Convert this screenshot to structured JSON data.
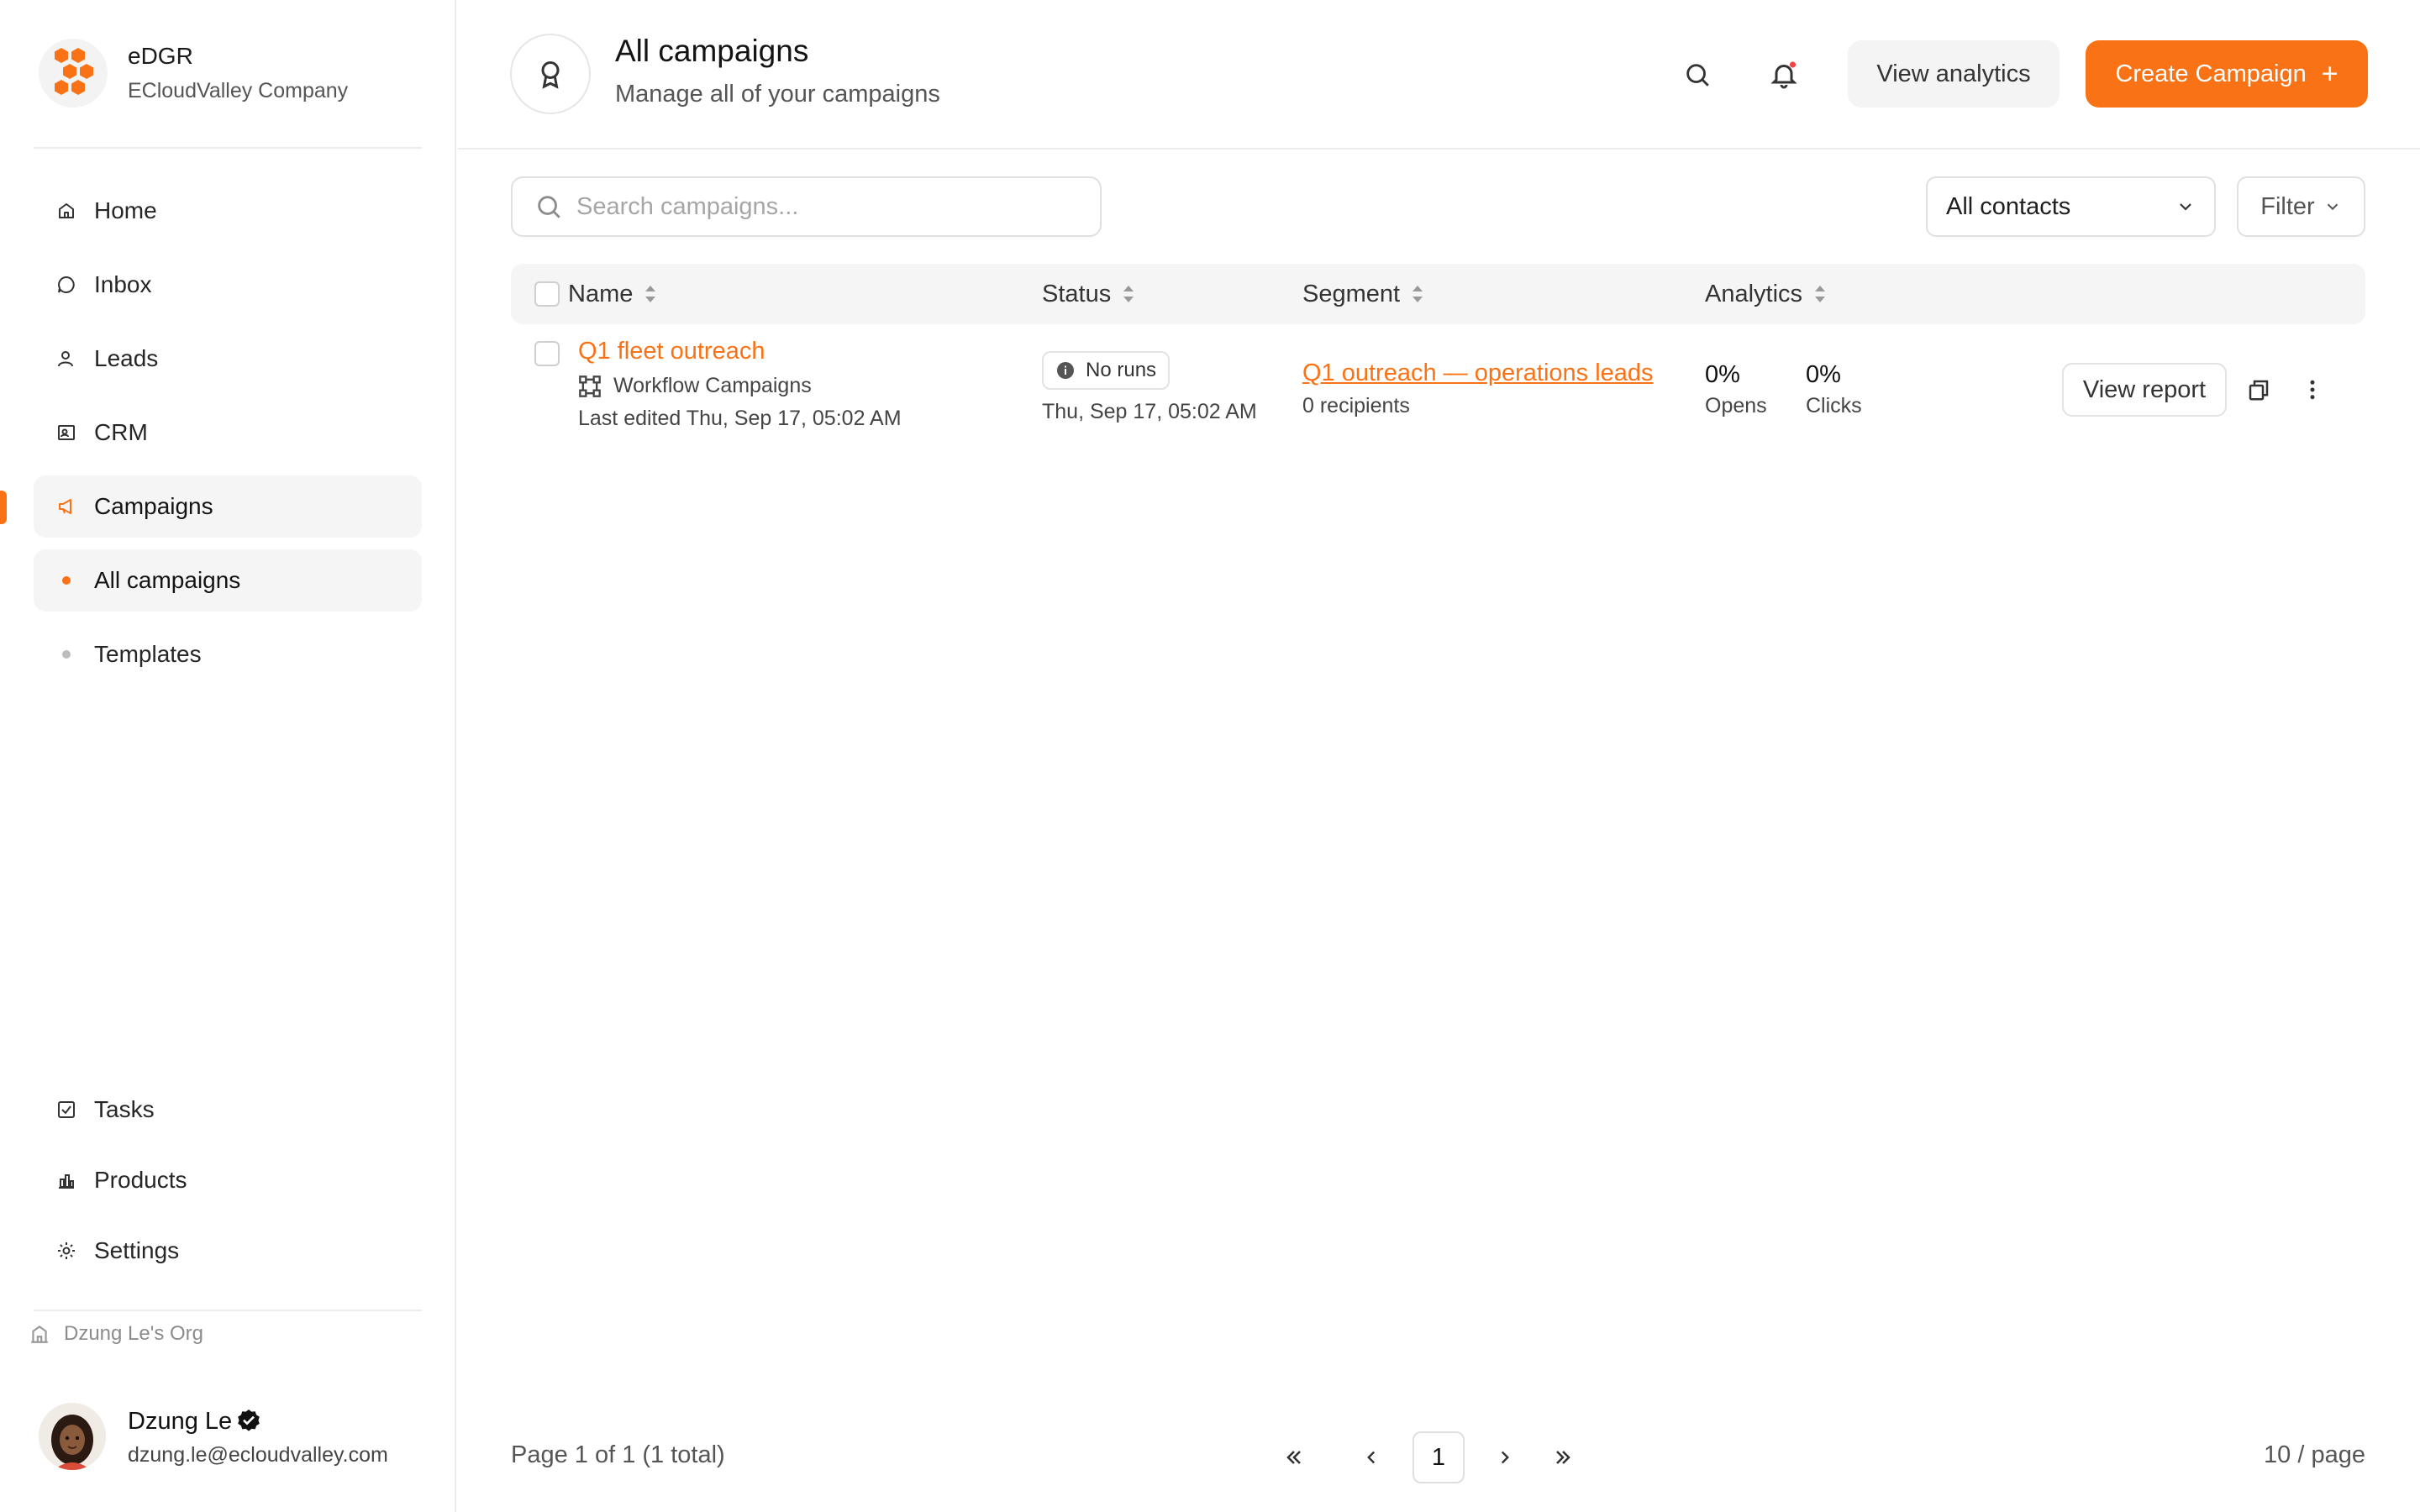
{
  "brand": {
    "name": "eDGR",
    "company": "ECloudValley Company"
  },
  "nav": {
    "home": "Home",
    "inbox": "Inbox",
    "leads": "Leads",
    "crm": "CRM",
    "campaigns": "Campaigns",
    "all_campaigns": "All campaigns",
    "templates": "Templates",
    "tasks": "Tasks",
    "products": "Products",
    "settings": "Settings"
  },
  "org": "Dzung Le's Org",
  "user": {
    "name": "Dzung Le",
    "email": "dzung.le@ecloudvalley.com"
  },
  "header": {
    "title": "All campaigns",
    "subtitle": "Manage all of your campaigns",
    "view_analytics": "View analytics",
    "create_campaign": "Create Campaign",
    "create_plus": "+"
  },
  "toolbar": {
    "search_placeholder": "Search campaigns...",
    "contacts_select": "All contacts",
    "filter_label": "Filter"
  },
  "table": {
    "columns": {
      "name": "Name",
      "status": "Status",
      "segment": "Segment",
      "analytics": "Analytics"
    },
    "rows": [
      {
        "name": "Q1 fleet outreach",
        "type": "Workflow Campaigns",
        "last_edited": "Last edited Thu, Sep 17, 05:02 AM",
        "status_badge": "No runs",
        "status_date": "Thu, Sep 17, 05:02 AM",
        "segment": "Q1 outreach — operations leads",
        "recipients": "0 recipients",
        "opens_value": "0%",
        "opens_label": "Opens",
        "clicks_value": "0%",
        "clicks_label": "Clicks",
        "view_report": "View report"
      }
    ]
  },
  "pagination": {
    "info": "Page 1 of 1 (1 total)",
    "current_page": "1",
    "per_page": "10 / page"
  },
  "colors": {
    "accent": "#f97316",
    "border": "#e0e0e0",
    "header_bg": "#f5f5f5"
  }
}
